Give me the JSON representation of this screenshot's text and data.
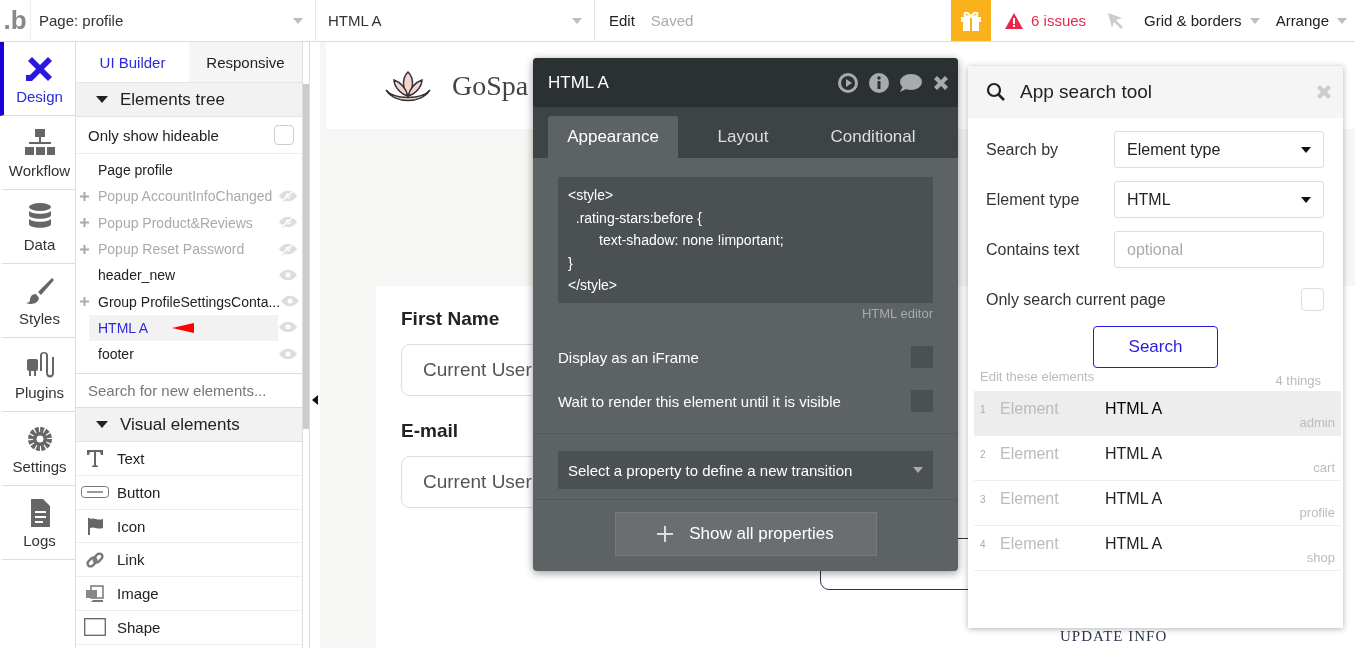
{
  "top_bar": {
    "logo": ".b",
    "page_selector": "Page: profile",
    "element_selector": "HTML A",
    "edit": "Edit",
    "saved": "Saved",
    "issues": "6 issues",
    "grid_menu": "Grid & borders",
    "arrange_menu": "Arrange"
  },
  "rail": [
    {
      "label": "Design",
      "kind": "design",
      "selected": true
    },
    {
      "label": "Workflow",
      "kind": "workflow",
      "selected": false
    },
    {
      "label": "Data",
      "kind": "data",
      "selected": false
    },
    {
      "label": "Styles",
      "kind": "styles",
      "selected": false
    },
    {
      "label": "Plugins",
      "kind": "plugins",
      "selected": false
    },
    {
      "label": "Settings",
      "kind": "settings",
      "selected": false
    },
    {
      "label": "Logs",
      "kind": "logs",
      "selected": false
    }
  ],
  "builder_tabs": [
    {
      "label": "UI Builder",
      "selected": true
    },
    {
      "label": "Responsive",
      "selected": false
    }
  ],
  "elements_tree": {
    "title": "Elements tree",
    "expanded": true,
    "hideable_label": "Only show hideable",
    "hideable_checked": false,
    "items": [
      {
        "label": "Page profile",
        "kind": "page",
        "expandable": false,
        "hidden": false,
        "selected": false
      },
      {
        "label": "Popup AccountInfoChanged",
        "kind": "element",
        "expandable": true,
        "hidden": true,
        "selected": false
      },
      {
        "label": "Popup Product&Reviews",
        "kind": "element",
        "expandable": true,
        "hidden": true,
        "selected": false
      },
      {
        "label": "Popup Reset Password",
        "kind": "element",
        "expandable": true,
        "hidden": true,
        "selected": false
      },
      {
        "label": "header_new",
        "kind": "element",
        "expandable": false,
        "hidden": false,
        "selected": false
      },
      {
        "label": "Group ProfileSettingsConta...",
        "kind": "element",
        "expandable": true,
        "hidden": false,
        "selected": false
      },
      {
        "label": "HTML A",
        "kind": "element",
        "expandable": false,
        "hidden": false,
        "selected": true
      },
      {
        "label": "footer",
        "kind": "element",
        "expandable": false,
        "hidden": false,
        "selected": false
      }
    ]
  },
  "element_search": {
    "placeholder": "Search for new elements..."
  },
  "visual_elements": {
    "title": "Visual elements",
    "expanded": true,
    "items": [
      {
        "label": "Text",
        "kind": "text"
      },
      {
        "label": "Button",
        "kind": "button"
      },
      {
        "label": "Icon",
        "kind": "icon"
      },
      {
        "label": "Link",
        "kind": "link"
      },
      {
        "label": "Image",
        "kind": "image"
      },
      {
        "label": "Shape",
        "kind": "shape"
      }
    ]
  },
  "canvas": {
    "brand": "GoSpa",
    "fields": [
      {
        "label": "First Name",
        "value": "Current User"
      },
      {
        "label": "E-mail",
        "value": "Current User"
      }
    ],
    "update_button": "UPDATE INFO"
  },
  "property_editor": {
    "title": "HTML A",
    "tabs": [
      {
        "label": "Appearance",
        "selected": true
      },
      {
        "label": "Layout",
        "selected": false
      },
      {
        "label": "Conditional",
        "selected": false
      }
    ],
    "code": "<style>\n  .rating-stars:before {\n        text-shadow: none !important;\n}\n</style>",
    "code_caption": "HTML editor",
    "options": [
      {
        "label": "Display as an iFrame",
        "checked": false
      },
      {
        "label": "Wait to render this element until it is visible",
        "checked": false
      }
    ],
    "transition_placeholder": "Select a property to define a new transition",
    "show_all": "Show all properties"
  },
  "search_tool": {
    "title": "App search tool",
    "fields": [
      {
        "label": "Search by",
        "kind": "dropdown",
        "value": "Element type"
      },
      {
        "label": "Element type",
        "kind": "dropdown",
        "value": "HTML"
      },
      {
        "label": "Contains text",
        "kind": "input",
        "placeholder": "optional"
      }
    ],
    "current_page": {
      "label": "Only search current page",
      "checked": false
    },
    "button": "Search",
    "results_caption": "Edit these elements",
    "results_count": "4 things",
    "results": [
      {
        "index": "1",
        "type": "Element",
        "name": "HTML A",
        "page": "admin",
        "selected": true
      },
      {
        "index": "2",
        "type": "Element",
        "name": "HTML A",
        "page": "cart",
        "selected": false
      },
      {
        "index": "3",
        "type": "Element",
        "name": "HTML A",
        "page": "profile",
        "selected": false
      },
      {
        "index": "4",
        "type": "Element",
        "name": "HTML A",
        "page": "shop",
        "selected": false
      }
    ]
  }
}
